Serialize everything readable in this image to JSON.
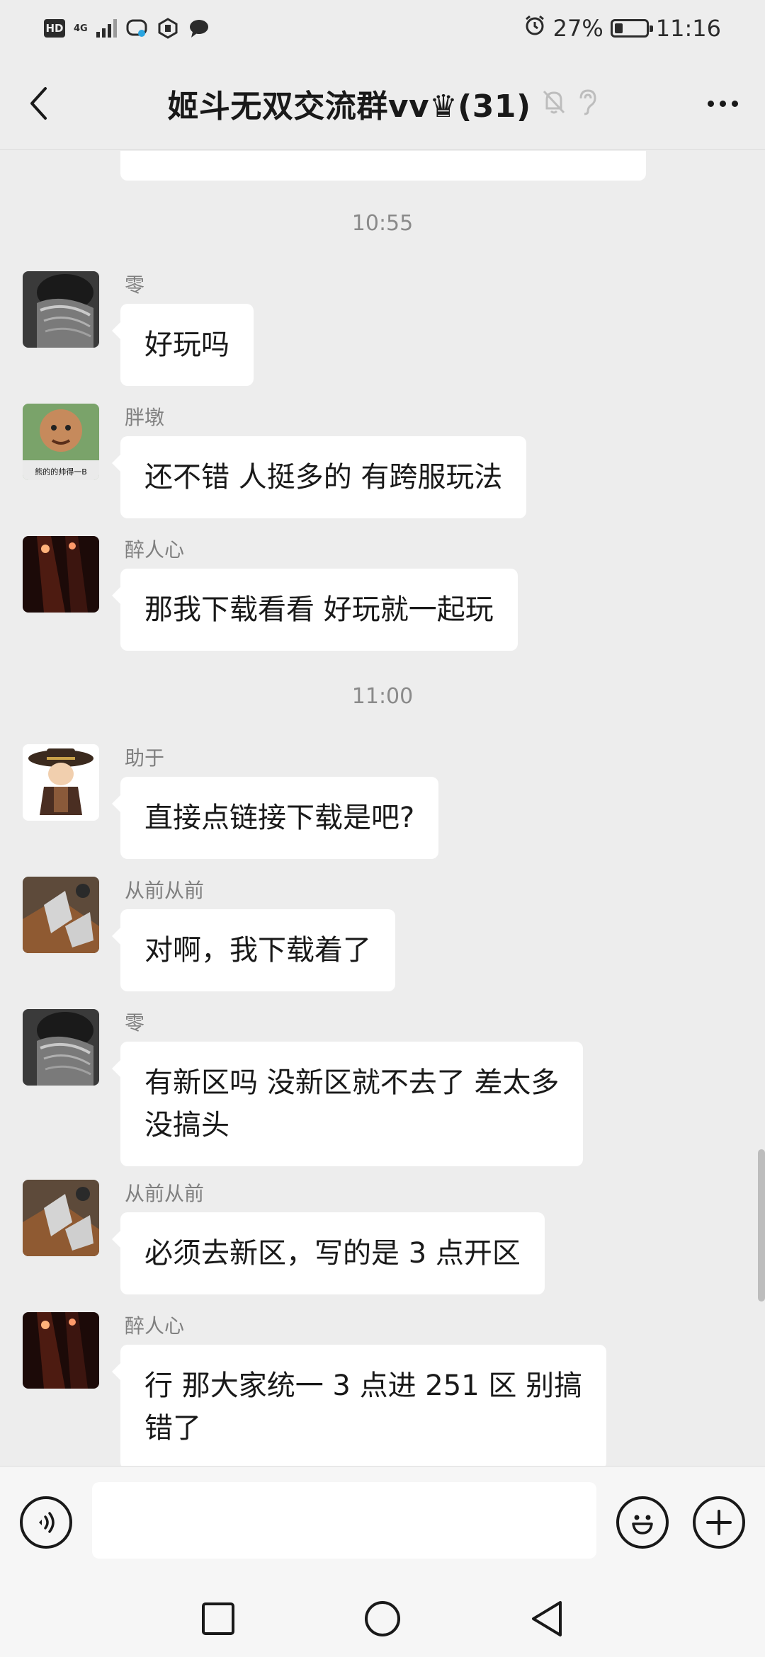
{
  "status_bar": {
    "hd_label": "HD",
    "network_label": "4G",
    "battery_percent": "27%",
    "battery_level": 0.27,
    "time": "11:16"
  },
  "header": {
    "title": "姬斗无双交流群vv♛(31)"
  },
  "messages": [
    {
      "type": "time",
      "text": "10:55"
    },
    {
      "type": "msg",
      "sender": "零",
      "avatar": "avatar-ling",
      "lines": [
        "好玩吗"
      ]
    },
    {
      "type": "msg",
      "sender": "胖墩",
      "avatar": "avatar-pangdun",
      "lines": [
        "还不错 人挺多的 有跨服玩法"
      ]
    },
    {
      "type": "msg",
      "sender": "醉人心",
      "avatar": "avatar-zuirenxin",
      "lines": [
        "那我下载看看 好玩就一起玩"
      ]
    },
    {
      "type": "time",
      "text": "11:00"
    },
    {
      "type": "msg",
      "sender": "助于",
      "avatar": "avatar-zhuyu",
      "lines": [
        "直接点链接下载是吧?"
      ]
    },
    {
      "type": "msg",
      "sender": "从前从前",
      "avatar": "avatar-congqian",
      "lines": [
        "对啊，我下载着了"
      ]
    },
    {
      "type": "msg",
      "sender": "零",
      "avatar": "avatar-ling",
      "lines": [
        "有新区吗 没新区就不去了 差太多",
        "没搞头"
      ]
    },
    {
      "type": "msg",
      "sender": "从前从前",
      "avatar": "avatar-congqian",
      "lines": [
        "必须去新区，写的是 3 点开区"
      ]
    },
    {
      "type": "msg",
      "sender": "醉人心",
      "avatar": "avatar-zuirenxin",
      "lines": [
        "行  那大家统一 3 点进 251 区 别搞",
        "错了"
      ]
    }
  ],
  "avatar_text": {
    "pangdun_caption": "熊的的帅得一B"
  },
  "input": {
    "value": "",
    "placeholder": ""
  },
  "icons": {
    "back": "back-arrow-icon",
    "mute": "mute-bell-icon",
    "ear": "ear-icon",
    "more": "more-dots-icon",
    "voice": "voice-icon",
    "emoji": "emoji-icon",
    "plus": "plus-icon",
    "nav_recents": "recents-square-icon",
    "nav_home": "home-circle-icon",
    "nav_back": "back-triangle-icon"
  }
}
